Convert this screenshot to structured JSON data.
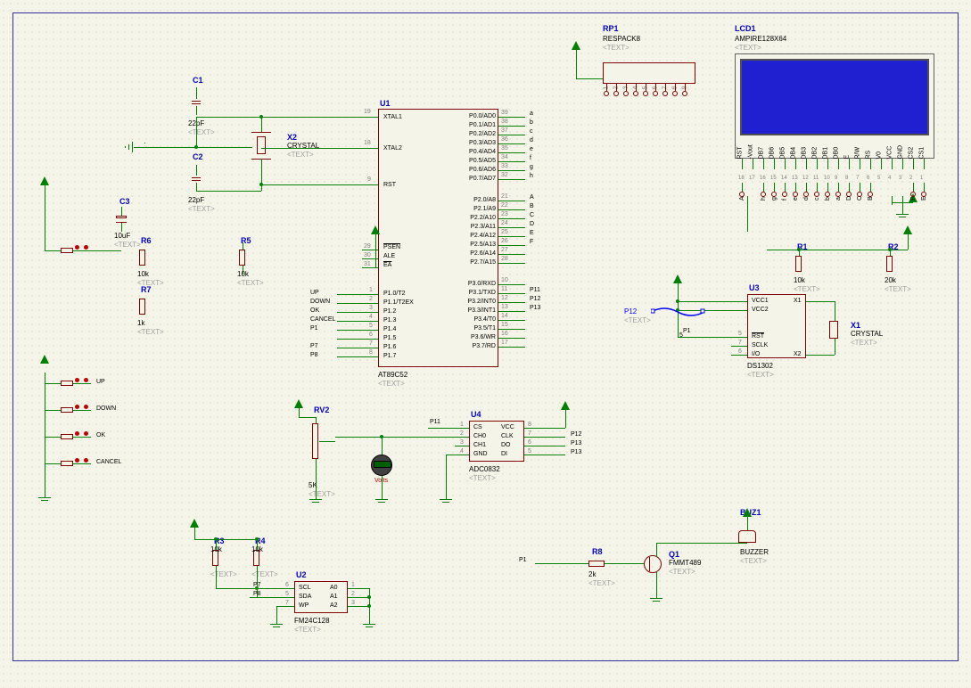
{
  "components": {
    "C1": {
      "ref": "C1",
      "value": "22pF",
      "text": "<TEXT>"
    },
    "C2": {
      "ref": "C2",
      "value": "22pF",
      "text": "<TEXT>"
    },
    "C3": {
      "ref": "C3",
      "value": "10uF",
      "text": "<TEXT>"
    },
    "X1": {
      "ref": "X1",
      "value": "CRYSTAL",
      "text": "<TEXT>"
    },
    "X2": {
      "ref": "X2",
      "value": "CRYSTAL",
      "text": "<TEXT>"
    },
    "R1": {
      "ref": "R1",
      "value": "10k",
      "text": "<TEXT>"
    },
    "R2": {
      "ref": "R2",
      "value": "20k",
      "text": "<TEXT>"
    },
    "R3": {
      "ref": "R3",
      "value": "10k",
      "text": "<TEXT>"
    },
    "R4": {
      "ref": "R4",
      "value": "10k",
      "text": "<TEXT>"
    },
    "R5": {
      "ref": "R5",
      "value": "10k",
      "text": "<TEXT>"
    },
    "R6": {
      "ref": "R6",
      "value": "10k",
      "text": "<TEXT>"
    },
    "R7": {
      "ref": "R7",
      "value": "1k",
      "text": "<TEXT>"
    },
    "R8": {
      "ref": "R8",
      "value": "2k",
      "text": "<TEXT>"
    },
    "RV2": {
      "ref": "RV2",
      "value": "5K",
      "text": "<TEXT>"
    },
    "RP1": {
      "ref": "RP1",
      "value": "RESPACK8",
      "text": "<TEXT>"
    },
    "Q1": {
      "ref": "Q1",
      "value": "FMMT489",
      "text": "<TEXT>"
    },
    "BUZ1": {
      "ref": "BUZ1",
      "value": "BUZZER",
      "text": "<TEXT>"
    },
    "LCD1": {
      "ref": "LCD1",
      "value": "AMPIRE128X64",
      "text": "<TEXT>"
    },
    "U1": {
      "ref": "U1",
      "value": "AT89C52",
      "text": "<TEXT>",
      "left_pins": [
        {
          "num": "19",
          "name": "XTAL1"
        },
        {
          "num": "18",
          "name": "XTAL2"
        },
        {
          "num": "9",
          "name": "RST"
        },
        {
          "num": "29",
          "name": "PSEN"
        },
        {
          "num": "30",
          "name": "ALE"
        },
        {
          "num": "31",
          "name": "EA"
        },
        {
          "num": "1",
          "name": "P1.0/T2"
        },
        {
          "num": "2",
          "name": "P1.1/T2EX"
        },
        {
          "num": "3",
          "name": "P1.2"
        },
        {
          "num": "4",
          "name": "P1.3"
        },
        {
          "num": "5",
          "name": "P1.4"
        },
        {
          "num": "6",
          "name": "P1.5"
        },
        {
          "num": "7",
          "name": "P1.6"
        },
        {
          "num": "8",
          "name": "P1.7"
        }
      ],
      "right_pins": [
        {
          "num": "39",
          "name": "P0.0/AD0",
          "net": "a"
        },
        {
          "num": "38",
          "name": "P0.1/AD1",
          "net": "b"
        },
        {
          "num": "37",
          "name": "P0.2/AD2",
          "net": "c"
        },
        {
          "num": "36",
          "name": "P0.3/AD3",
          "net": "d"
        },
        {
          "num": "35",
          "name": "P0.4/AD4",
          "net": "e"
        },
        {
          "num": "34",
          "name": "P0.5/AD5",
          "net": "f"
        },
        {
          "num": "33",
          "name": "P0.6/AD6",
          "net": "g"
        },
        {
          "num": "32",
          "name": "P0.7/AD7",
          "net": "h"
        },
        {
          "num": "21",
          "name": "P2.0/A8",
          "net": "A"
        },
        {
          "num": "22",
          "name": "P2.1/A9",
          "net": "B"
        },
        {
          "num": "23",
          "name": "P2.2/A10",
          "net": "C"
        },
        {
          "num": "24",
          "name": "P2.3/A11",
          "net": "D"
        },
        {
          "num": "25",
          "name": "P2.4/A12",
          "net": "E"
        },
        {
          "num": "26",
          "name": "P2.5/A13",
          "net": "F"
        },
        {
          "num": "27",
          "name": "P2.6/A14",
          "net": ""
        },
        {
          "num": "28",
          "name": "P2.7/A15",
          "net": ""
        },
        {
          "num": "10",
          "name": "P3.0/RXD",
          "net": ""
        },
        {
          "num": "11",
          "name": "P3.1/TXD",
          "net": "P11"
        },
        {
          "num": "12",
          "name": "P3.2/INT0",
          "net": "P12"
        },
        {
          "num": "13",
          "name": "P3.3/INT1",
          "net": "P13"
        },
        {
          "num": "14",
          "name": "P3.4/T0",
          "net": ""
        },
        {
          "num": "15",
          "name": "P3.5/T1",
          "net": ""
        },
        {
          "num": "16",
          "name": "P3.6/WR",
          "net": ""
        },
        {
          "num": "17",
          "name": "P3.7/RD",
          "net": ""
        }
      ],
      "left_nets": [
        "UP",
        "DOWN",
        "OK",
        "CANCEL",
        "P1",
        "",
        "P7",
        "P8"
      ]
    },
    "U2": {
      "ref": "U2",
      "value": "FM24C128",
      "text": "<TEXT>",
      "pins_left": [
        {
          "num": "6",
          "name": "SCL"
        },
        {
          "num": "5",
          "name": "SDA"
        },
        {
          "num": "7",
          "name": "WP"
        }
      ],
      "pins_right": [
        {
          "num": "1",
          "name": "A0"
        },
        {
          "num": "2",
          "name": "A1"
        },
        {
          "num": "3",
          "name": "A2"
        }
      ]
    },
    "U3": {
      "ref": "U3",
      "value": "DS1302",
      "text": "<TEXT>",
      "pins_left": [
        {
          "num": "",
          "name": "VCC1"
        },
        {
          "num": "",
          "name": "VCC2"
        },
        {
          "num": "5",
          "name": "RST"
        },
        {
          "num": "7",
          "name": "SCLK"
        },
        {
          "num": "6",
          "name": "I/O"
        }
      ],
      "pins_right": [
        {
          "num": "",
          "name": "X1"
        },
        {
          "num": "",
          "name": "X2"
        }
      ]
    },
    "U4": {
      "ref": "U4",
      "value": "ADC0832",
      "text": "<TEXT>",
      "pins_left": [
        {
          "num": "1",
          "name": "CS"
        },
        {
          "num": "2",
          "name": "CH0"
        },
        {
          "num": "3",
          "name": "CH1"
        },
        {
          "num": "4",
          "name": "GND"
        }
      ],
      "pins_right": [
        {
          "num": "8",
          "name": "VCC"
        },
        {
          "num": "7",
          "name": "CLK"
        },
        {
          "num": "6",
          "name": "DO"
        },
        {
          "num": "5",
          "name": "DI"
        }
      ]
    }
  },
  "buttons": [
    "UP",
    "DOWN",
    "OK",
    "CANCEL"
  ],
  "rp1_pins": [
    "1",
    "2",
    "3",
    "4",
    "5",
    "6",
    "7",
    "8",
    "9"
  ],
  "lcd_pins": [
    "18",
    "17",
    "16",
    "15",
    "14",
    "13",
    "12",
    "11",
    "10",
    "9",
    "8",
    "7",
    "6",
    "5",
    "4",
    "3",
    "2",
    "1"
  ],
  "lcd_pin_names": [
    "RST",
    "-Vout",
    "DB7",
    "DB6",
    "DB5",
    "DB4",
    "DB3",
    "DB2",
    "DB1",
    "DB0",
    "E",
    "R/W",
    "RS",
    "V0",
    "VCC",
    "GND",
    "CS2",
    "CS1"
  ],
  "lcd_nets": [
    "A",
    "",
    "h",
    "g",
    "f",
    "e",
    "d",
    "c",
    "b",
    "a",
    "D",
    "C",
    "B",
    "",
    "",
    "",
    "F",
    "E"
  ],
  "voltmeter_label": "Volts",
  "selected": {
    "net": "P12",
    "text": "<TEXT>"
  },
  "u2_nets": {
    "left": [
      "P7",
      "P8"
    ]
  },
  "u4_nets": {
    "left": [
      "P11"
    ],
    "right": [
      "P12",
      "P13",
      "P13"
    ]
  },
  "u3_nets": {
    "left": [
      "P1"
    ]
  },
  "r8_net": "P1"
}
